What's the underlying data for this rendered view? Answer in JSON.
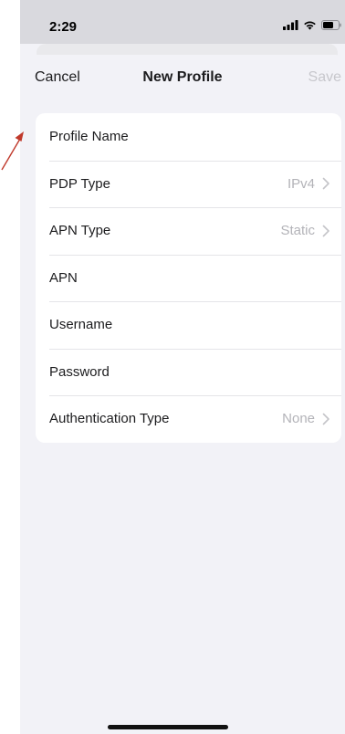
{
  "status_bar": {
    "time": "2:29"
  },
  "nav": {
    "cancel_label": "Cancel",
    "title": "New Profile",
    "save_label": "Save"
  },
  "form": {
    "rows": [
      {
        "label": "Profile Name",
        "value": ""
      },
      {
        "label": "PDP Type",
        "value": "IPv4"
      },
      {
        "label": "APN Type",
        "value": "Static"
      },
      {
        "label": "APN",
        "value": ""
      },
      {
        "label": "Username",
        "value": ""
      },
      {
        "label": "Password",
        "value": ""
      },
      {
        "label": "Authentication Type",
        "value": "None"
      }
    ]
  },
  "colors": {
    "accent_arrow": "#c0392b",
    "disabled_text": "#c7c7cc"
  },
  "icons": [
    "signal-icon",
    "wifi-icon",
    "battery-icon",
    "chevron-right-icon",
    "annotation-arrow-icon"
  ]
}
